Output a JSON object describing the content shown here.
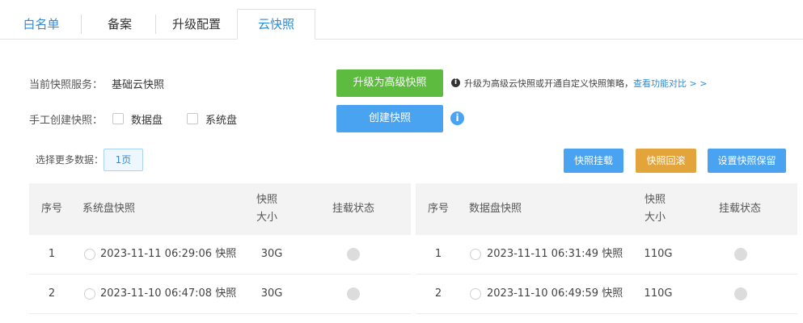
{
  "tabs": [
    "白名单",
    "备案",
    "升级配置",
    "云快照"
  ],
  "current_service": {
    "label": "当前快照服务：",
    "value": "基础云快照"
  },
  "manual_create": {
    "label": "手工创建快照：",
    "options": [
      "数据盘",
      "系统盘"
    ]
  },
  "buttons": {
    "upgrade": "升级为高级快照",
    "create": "创建快照",
    "mount": "快照挂载",
    "rollback": "快照回滚",
    "keep": "设置快照保留"
  },
  "upgrade_hint": {
    "text": "升级为高级云快照或开通自定义快照策略，",
    "link": "查看功能对比 > >"
  },
  "more_data": {
    "label": "选择更多数据：",
    "page": "1页"
  },
  "system_table": {
    "headers": [
      "序号",
      "系统盘快照",
      "快照大小",
      "挂载状态"
    ],
    "rows": [
      {
        "no": "1",
        "name": "2023-11-11 06:29:06 快照",
        "size": "30G"
      },
      {
        "no": "2",
        "name": "2023-11-10 06:47:08 快照",
        "size": "30G"
      }
    ]
  },
  "data_table": {
    "headers": [
      "序号",
      "数据盘快照",
      "快照大小",
      "挂载状态"
    ],
    "rows": [
      {
        "no": "1",
        "name": "2023-11-11 06:31:49 快照",
        "size": "110G"
      },
      {
        "no": "2",
        "name": "2023-11-10 06:49:59 快照",
        "size": "110G"
      }
    ]
  },
  "colors": {
    "accent": "#2f8ad8",
    "green": "#5dbb3f",
    "blue": "#4aa3f0",
    "orange": "#e2a43b"
  }
}
